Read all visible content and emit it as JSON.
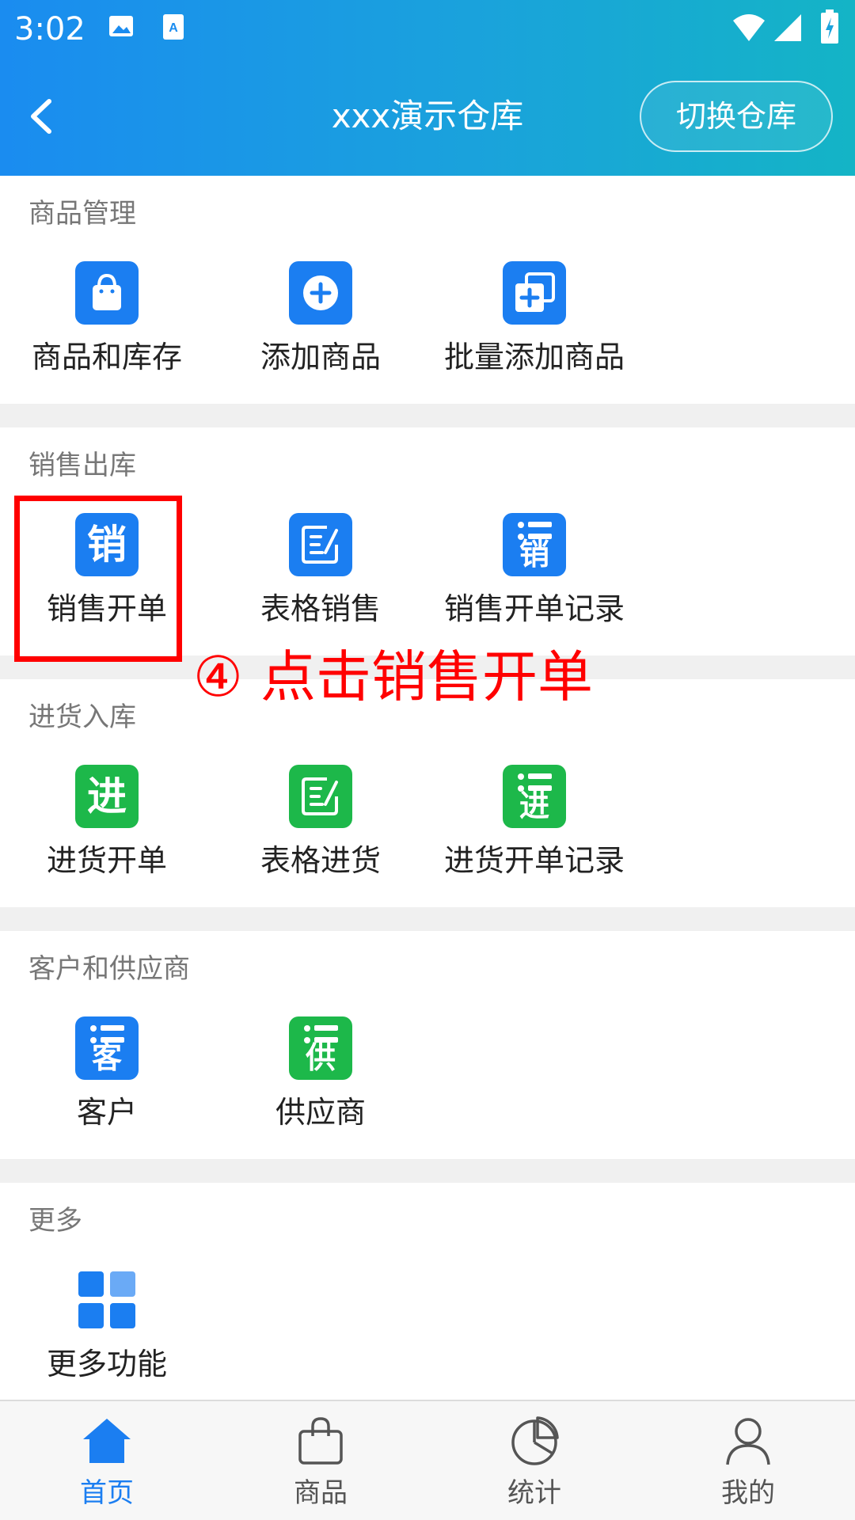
{
  "status_bar": {
    "time": "3:02",
    "icons": [
      "image-icon",
      "text-icon",
      "wifi-icon",
      "signal-icon",
      "battery-icon"
    ]
  },
  "nav": {
    "title": "xxx演示仓库",
    "switch_label": "切换仓库",
    "back_icon": "back-arrow-icon"
  },
  "sections": {
    "goods": {
      "title": "商品管理",
      "items": [
        {
          "label": "商品和库存",
          "icon": "shopping-bag-icon"
        },
        {
          "label": "添加商品",
          "icon": "plus-circle-icon"
        },
        {
          "label": "批量添加商品",
          "icon": "batch-add-icon"
        }
      ]
    },
    "sales": {
      "title": "销售出库",
      "items": [
        {
          "label": "销售开单",
          "icon": "sales-order-icon",
          "icon_text": "销"
        },
        {
          "label": "表格销售",
          "icon": "table-edit-icon"
        },
        {
          "label": "销售开单记录",
          "icon": "sales-record-icon",
          "icon_text": "销"
        }
      ]
    },
    "purchase": {
      "title": "进货入库",
      "items": [
        {
          "label": "进货开单",
          "icon": "purchase-order-icon",
          "icon_text": "进"
        },
        {
          "label": "表格进货",
          "icon": "table-edit-icon"
        },
        {
          "label": "进货开单记录",
          "icon": "purchase-record-icon",
          "icon_text": "进"
        }
      ]
    },
    "partners": {
      "title": "客户和供应商",
      "items": [
        {
          "label": "客户",
          "icon": "customer-icon",
          "icon_text": "客"
        },
        {
          "label": "供应商",
          "icon": "supplier-icon",
          "icon_text": "供"
        }
      ]
    },
    "more": {
      "title": "更多",
      "items": [
        {
          "label": "更多功能",
          "icon": "grid-icon"
        }
      ]
    }
  },
  "annotation": {
    "text": "④ 点击销售开单"
  },
  "bottom_nav": {
    "tabs": [
      {
        "label": "首页",
        "icon": "home-icon",
        "active": true
      },
      {
        "label": "商品",
        "icon": "bag-icon",
        "active": false
      },
      {
        "label": "统计",
        "icon": "pie-chart-icon",
        "active": false
      },
      {
        "label": "我的",
        "icon": "user-icon",
        "active": false
      }
    ]
  },
  "colors": {
    "header_start": "#1a8cf0",
    "header_end": "#14b4c6",
    "blue_icon": "#1b7ef1",
    "green_icon": "#1db84a",
    "annotation_red": "#ff0000"
  }
}
